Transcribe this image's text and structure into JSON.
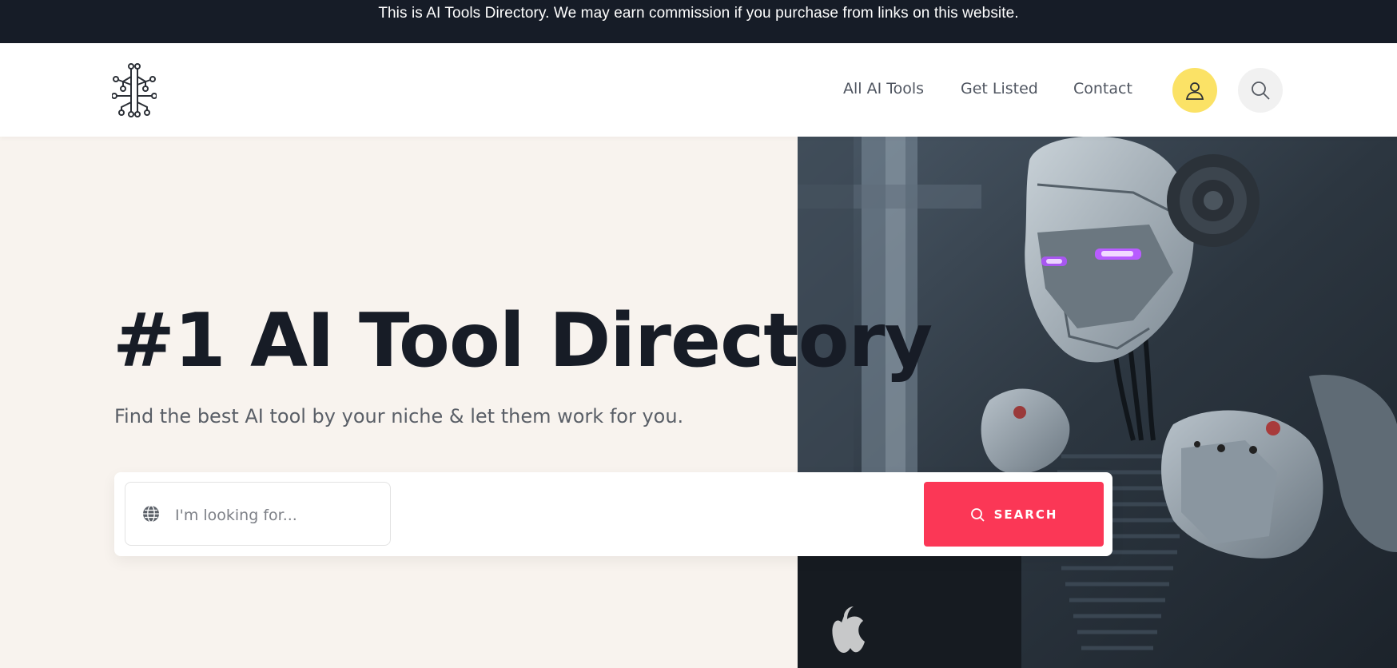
{
  "announcement": "This is AI Tools Directory. We may earn commission if you purchase from links on this website.",
  "nav": {
    "links": [
      "All AI Tools",
      "Get Listed",
      "Contact"
    ]
  },
  "hero": {
    "title": "#1 AI Tool Directory",
    "subtitle": "Find the best AI tool by your niche & let them work for you.",
    "search_placeholder": "I'm looking for...",
    "search_button": "SEARCH"
  },
  "colors": {
    "topbar": "#161c27",
    "accent": "#fb3756",
    "user_button": "#fbe266",
    "hero_background": "#f8f3ee",
    "title": "#171c26"
  },
  "icons": [
    "circuit-logo-icon",
    "user-icon",
    "search-icon",
    "globe-icon",
    "search-icon"
  ]
}
